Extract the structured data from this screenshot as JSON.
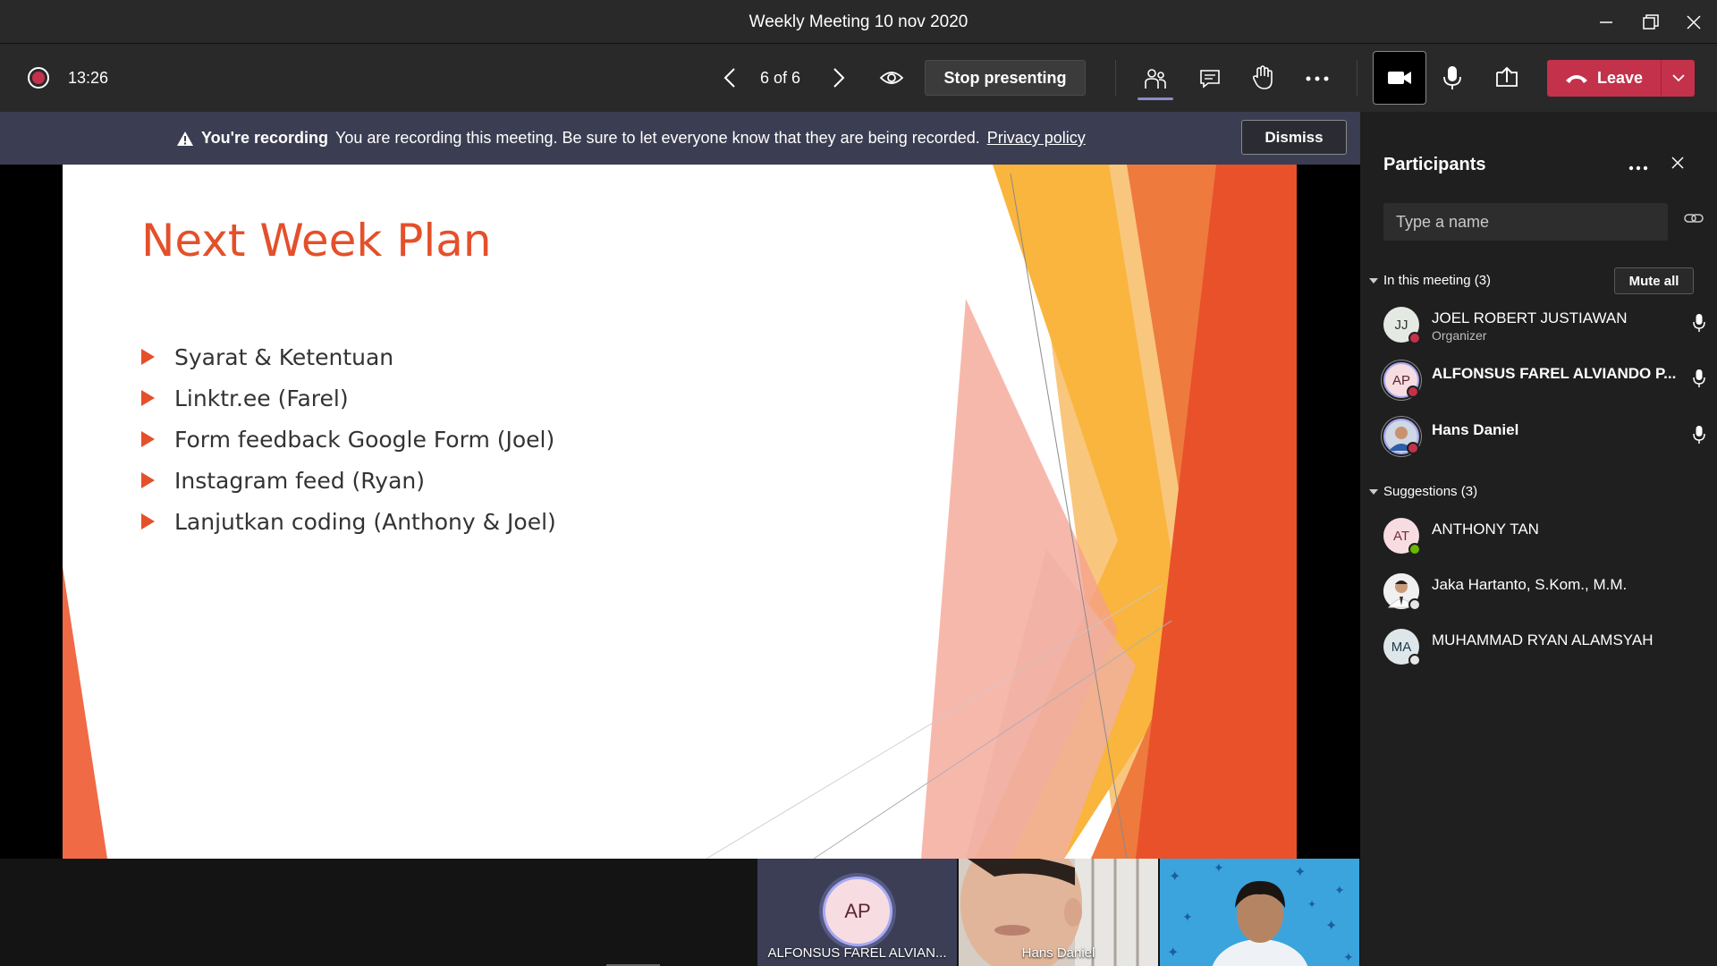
{
  "window": {
    "title": "Weekly Meeting 10 nov 2020"
  },
  "controls": {
    "timer": "13:26",
    "slide_counter": "6 of 6",
    "stop_presenting_label": "Stop presenting",
    "leave_label": "Leave",
    "icons": [
      "record-indicator-icon",
      "chevron-left-icon",
      "chevron-right-icon",
      "eye-icon",
      "people-icon",
      "chat-icon",
      "raise-hand-icon",
      "more-icon",
      "camera-icon",
      "microphone-icon",
      "share-tray-icon",
      "phone-hangup-icon",
      "chevron-down-icon"
    ]
  },
  "banner": {
    "title": "You're recording",
    "message": "You are recording this meeting. Be sure to let everyone know that they are being recorded.",
    "link": "Privacy policy",
    "dismiss_label": "Dismiss"
  },
  "slide": {
    "title": "Next Week Plan",
    "bullets": [
      "Syarat & Ketentuan",
      "Linktr.ee (Farel)",
      "Form feedback Google Form (Joel)",
      "Instagram feed (Ryan)",
      "Lanjutkan coding (Anthony & Joel)"
    ],
    "accent_color": "#e4502a"
  },
  "video_tiles": [
    {
      "initials": "AP",
      "name": "ALFONSUS FAREL ALVIAN..."
    },
    {
      "name": "Hans Daniel"
    },
    {
      "name": ""
    }
  ],
  "panel": {
    "title": "Participants",
    "search_placeholder": "Type a name",
    "in_meeting_label": "In this meeting (3)",
    "mute_all_label": "Mute all",
    "in_meeting": [
      {
        "initials": "JJ",
        "name": "JOEL ROBERT JUSTIAWAN",
        "role": "Organizer"
      },
      {
        "initials": "AP",
        "name": "ALFONSUS FAREL ALVIANDO P..."
      },
      {
        "name": "Hans Daniel"
      }
    ],
    "suggestions_label": "Suggestions (3)",
    "suggestions": [
      {
        "initials": "AT",
        "name": "ANTHONY TAN"
      },
      {
        "name": "Jaka Hartanto, S.Kom., M.M."
      },
      {
        "initials": "MA",
        "name": "MUHAMMAD RYAN ALAMSYAH"
      }
    ]
  },
  "colors": {
    "recording_red": "#c4314b",
    "leave_red": "#c4314b",
    "banner_bg": "#3b3d52",
    "presence_busy": "#c4314b",
    "presence_available": "#6bb700"
  }
}
